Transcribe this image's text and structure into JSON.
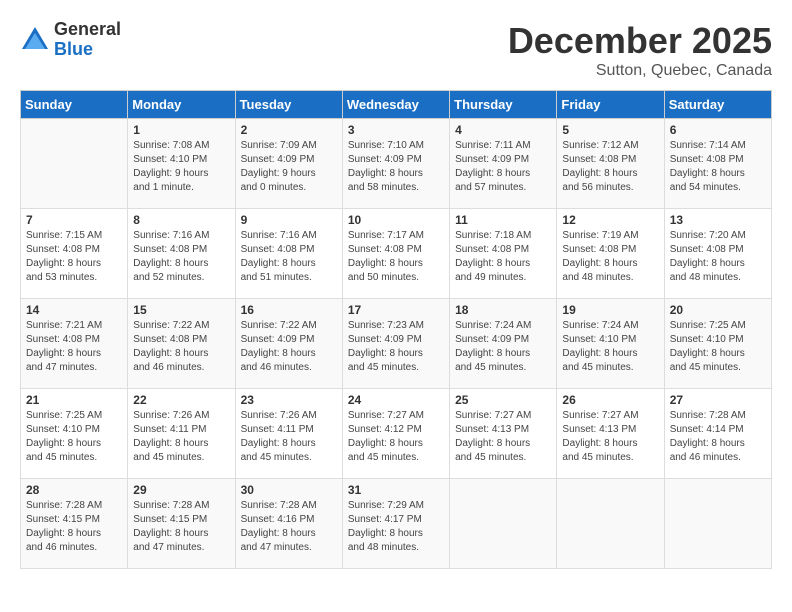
{
  "logo": {
    "general": "General",
    "blue": "Blue"
  },
  "title": "December 2025",
  "subtitle": "Sutton, Quebec, Canada",
  "days_of_week": [
    "Sunday",
    "Monday",
    "Tuesday",
    "Wednesday",
    "Thursday",
    "Friday",
    "Saturday"
  ],
  "weeks": [
    [
      {
        "day": "",
        "info": ""
      },
      {
        "day": "1",
        "info": "Sunrise: 7:08 AM\nSunset: 4:10 PM\nDaylight: 9 hours\nand 1 minute."
      },
      {
        "day": "2",
        "info": "Sunrise: 7:09 AM\nSunset: 4:09 PM\nDaylight: 9 hours\nand 0 minutes."
      },
      {
        "day": "3",
        "info": "Sunrise: 7:10 AM\nSunset: 4:09 PM\nDaylight: 8 hours\nand 58 minutes."
      },
      {
        "day": "4",
        "info": "Sunrise: 7:11 AM\nSunset: 4:09 PM\nDaylight: 8 hours\nand 57 minutes."
      },
      {
        "day": "5",
        "info": "Sunrise: 7:12 AM\nSunset: 4:08 PM\nDaylight: 8 hours\nand 56 minutes."
      },
      {
        "day": "6",
        "info": "Sunrise: 7:14 AM\nSunset: 4:08 PM\nDaylight: 8 hours\nand 54 minutes."
      }
    ],
    [
      {
        "day": "7",
        "info": "Sunrise: 7:15 AM\nSunset: 4:08 PM\nDaylight: 8 hours\nand 53 minutes."
      },
      {
        "day": "8",
        "info": "Sunrise: 7:16 AM\nSunset: 4:08 PM\nDaylight: 8 hours\nand 52 minutes."
      },
      {
        "day": "9",
        "info": "Sunrise: 7:16 AM\nSunset: 4:08 PM\nDaylight: 8 hours\nand 51 minutes."
      },
      {
        "day": "10",
        "info": "Sunrise: 7:17 AM\nSunset: 4:08 PM\nDaylight: 8 hours\nand 50 minutes."
      },
      {
        "day": "11",
        "info": "Sunrise: 7:18 AM\nSunset: 4:08 PM\nDaylight: 8 hours\nand 49 minutes."
      },
      {
        "day": "12",
        "info": "Sunrise: 7:19 AM\nSunset: 4:08 PM\nDaylight: 8 hours\nand 48 minutes."
      },
      {
        "day": "13",
        "info": "Sunrise: 7:20 AM\nSunset: 4:08 PM\nDaylight: 8 hours\nand 48 minutes."
      }
    ],
    [
      {
        "day": "14",
        "info": "Sunrise: 7:21 AM\nSunset: 4:08 PM\nDaylight: 8 hours\nand 47 minutes."
      },
      {
        "day": "15",
        "info": "Sunrise: 7:22 AM\nSunset: 4:08 PM\nDaylight: 8 hours\nand 46 minutes."
      },
      {
        "day": "16",
        "info": "Sunrise: 7:22 AM\nSunset: 4:09 PM\nDaylight: 8 hours\nand 46 minutes."
      },
      {
        "day": "17",
        "info": "Sunrise: 7:23 AM\nSunset: 4:09 PM\nDaylight: 8 hours\nand 45 minutes."
      },
      {
        "day": "18",
        "info": "Sunrise: 7:24 AM\nSunset: 4:09 PM\nDaylight: 8 hours\nand 45 minutes."
      },
      {
        "day": "19",
        "info": "Sunrise: 7:24 AM\nSunset: 4:10 PM\nDaylight: 8 hours\nand 45 minutes."
      },
      {
        "day": "20",
        "info": "Sunrise: 7:25 AM\nSunset: 4:10 PM\nDaylight: 8 hours\nand 45 minutes."
      }
    ],
    [
      {
        "day": "21",
        "info": "Sunrise: 7:25 AM\nSunset: 4:10 PM\nDaylight: 8 hours\nand 45 minutes."
      },
      {
        "day": "22",
        "info": "Sunrise: 7:26 AM\nSunset: 4:11 PM\nDaylight: 8 hours\nand 45 minutes."
      },
      {
        "day": "23",
        "info": "Sunrise: 7:26 AM\nSunset: 4:11 PM\nDaylight: 8 hours\nand 45 minutes."
      },
      {
        "day": "24",
        "info": "Sunrise: 7:27 AM\nSunset: 4:12 PM\nDaylight: 8 hours\nand 45 minutes."
      },
      {
        "day": "25",
        "info": "Sunrise: 7:27 AM\nSunset: 4:13 PM\nDaylight: 8 hours\nand 45 minutes."
      },
      {
        "day": "26",
        "info": "Sunrise: 7:27 AM\nSunset: 4:13 PM\nDaylight: 8 hours\nand 45 minutes."
      },
      {
        "day": "27",
        "info": "Sunrise: 7:28 AM\nSunset: 4:14 PM\nDaylight: 8 hours\nand 46 minutes."
      }
    ],
    [
      {
        "day": "28",
        "info": "Sunrise: 7:28 AM\nSunset: 4:15 PM\nDaylight: 8 hours\nand 46 minutes."
      },
      {
        "day": "29",
        "info": "Sunrise: 7:28 AM\nSunset: 4:15 PM\nDaylight: 8 hours\nand 47 minutes."
      },
      {
        "day": "30",
        "info": "Sunrise: 7:28 AM\nSunset: 4:16 PM\nDaylight: 8 hours\nand 47 minutes."
      },
      {
        "day": "31",
        "info": "Sunrise: 7:29 AM\nSunset: 4:17 PM\nDaylight: 8 hours\nand 48 minutes."
      },
      {
        "day": "",
        "info": ""
      },
      {
        "day": "",
        "info": ""
      },
      {
        "day": "",
        "info": ""
      }
    ]
  ]
}
